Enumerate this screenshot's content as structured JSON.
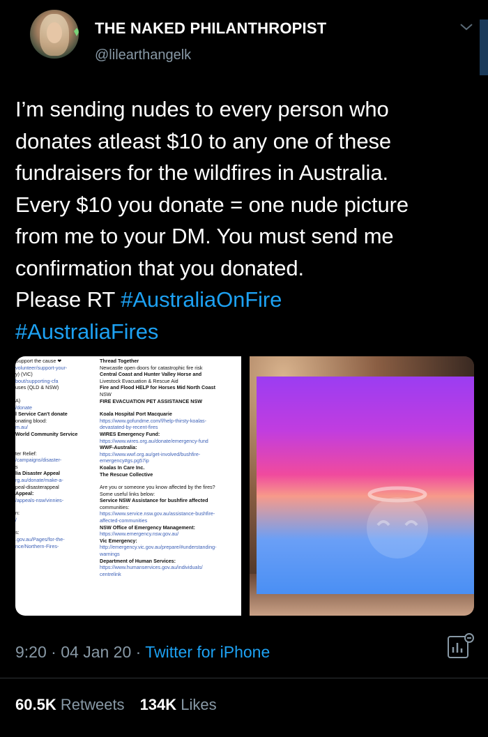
{
  "profile": {
    "display_name": "THE NAKED PHILANTHROPIST",
    "handle": "@lilearthangelk"
  },
  "tweet": {
    "text_lines": [
      "I’m sending nudes to every person who",
      "donates atleast $10 to any one of these",
      "fundraisers for the wildfires in Australia.",
      "Every $10 you donate = one nude picture",
      "from me to your DM. You must send me",
      "confirmation that you donated."
    ],
    "rt_prefix": "Please RT ",
    "hashtags": [
      "#AustraliaOnFire",
      "#AustraliaFires"
    ]
  },
  "media": {
    "left_image_col1": [
      "Support the cause ❤",
      "volunteer/support-your-",
      "y) (VIC)",
      "bout/supporting-cfa",
      "uses (QLD & NSW)",
      "A)",
      "/donate",
      "l Service Can't donate",
      "onating blood:",
      "m.au/",
      "World Community Service",
      "ter Relief:",
      "/campaigns/disaster-",
      "s",
      "lia Disaster Appeal",
      "rg.au/donate/make-a-",
      "peal-disasterappeal",
      "Appeal:",
      "/appeals-nsw/vinnies-",
      "n:",
      "/",
      "s:",
      ".gov.au/Pages/for-the-",
      "nce/Northern-Fires-"
    ],
    "left_image_col2": [
      "Thread Together",
      "Newcastle open doors for catastrophic fire risk",
      "Central Coast and Hunter Valley Horse and",
      "Livestock Evacuation & Rescue Aid",
      "Fire and Flood HELP for Horses Mid North Coast",
      "NSW",
      "FIRE EVACUATION PET ASSISTANCE NSW",
      "Koala Hospital Port Macquarie",
      "https://www.gofundme.com/f/help-thirsty-koalas-",
      "devastated-by-recent-fires",
      "WIRES Emergency Fund:",
      "https://www.wires.org.au/donate/emergency-fund",
      "WWF-Australia:",
      "https://www.wwf.org.au/get-involved/bushfire-",
      "emergency#gs.pg57ip",
      "Koalas In Care Inc.",
      "The Rescue Collective",
      "Are you or someone you know affected by the fires?",
      "Some useful links below:",
      "Service NSW Assistance for bushfire affected",
      "communities:",
      "https://www.service.nsw.gov.au/assistance-bushfire-",
      "affected-communities",
      "NSW Office of Emergency Management:",
      "https://www.emergency.nsw.gov.au/",
      "Vic Emergency:",
      "http://emergency.vic.gov.au/prepare/#understanding-",
      "warnings",
      "Department of Human Services:",
      "https://www.humanservices.gov.au/individuals/",
      "centrelink"
    ]
  },
  "meta": {
    "time": "9:20",
    "date": "04 Jan 20",
    "source": "Twitter for iPhone",
    "separator": " · "
  },
  "stats": {
    "retweets_count": "60.5K",
    "retweets_label": "Retweets",
    "likes_count": "134K",
    "likes_label": "Likes"
  },
  "icons": {
    "chevron": "chevron-down-icon",
    "analytics": "tweet-analytics-icon"
  },
  "colors": {
    "background": "#000000",
    "accent": "#1da1f2",
    "muted": "#8899a6"
  }
}
